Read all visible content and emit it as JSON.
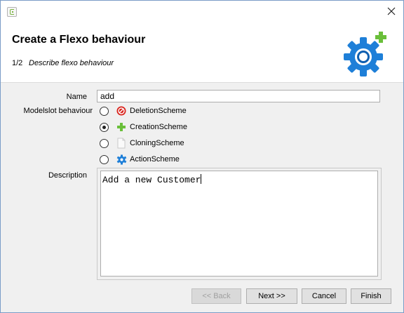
{
  "window": {
    "title": ""
  },
  "header": {
    "title": "Create a Flexo behaviour",
    "step_number": "1/2",
    "step_description": "Describe flexo behaviour"
  },
  "form": {
    "name_label": "Name",
    "name_value": "add",
    "behaviour_label": "Modelslot behaviour",
    "options": [
      {
        "label": "DeletionScheme",
        "icon": "deletion-icon",
        "selected": false
      },
      {
        "label": "CreationScheme",
        "icon": "creation-plus-icon",
        "selected": true
      },
      {
        "label": "CloningScheme",
        "icon": "cloning-page-icon",
        "selected": false
      },
      {
        "label": "ActionScheme",
        "icon": "action-gear-icon",
        "selected": false
      }
    ],
    "description_label": "Description",
    "description_value": "Add a new Customer"
  },
  "buttons": {
    "back": "<< Back",
    "next": "Next >>",
    "cancel": "Cancel",
    "finish": "Finish"
  },
  "colors": {
    "gear_blue": "#1e7fd8",
    "plus_green": "#6abf3a",
    "deletion_red": "#d9231c"
  }
}
